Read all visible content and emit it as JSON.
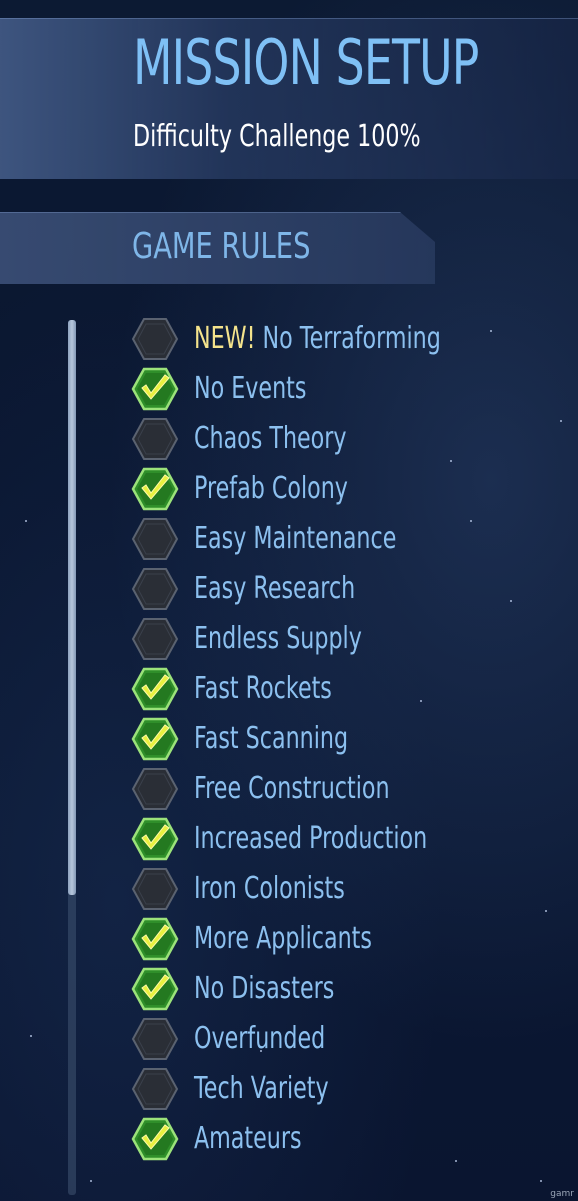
{
  "header": {
    "title": "MISSION SETUP",
    "subtitle": "Difficulty Challenge 100%"
  },
  "section": {
    "title": "GAME RULES"
  },
  "rules": [
    {
      "new_tag": "NEW!",
      "label": "No Terraforming",
      "checked": false
    },
    {
      "label": "No Events",
      "checked": true
    },
    {
      "label": "Chaos Theory",
      "checked": false
    },
    {
      "label": "Prefab Colony",
      "checked": true
    },
    {
      "label": "Easy Maintenance",
      "checked": false
    },
    {
      "label": "Easy Research",
      "checked": false
    },
    {
      "label": "Endless Supply",
      "checked": false
    },
    {
      "label": "Fast Rockets",
      "checked": true
    },
    {
      "label": "Fast Scanning",
      "checked": true
    },
    {
      "label": "Free Construction",
      "checked": false
    },
    {
      "label": "Increased Production",
      "checked": true
    },
    {
      "label": "Iron Colonists",
      "checked": false
    },
    {
      "label": "More Applicants",
      "checked": true
    },
    {
      "label": "No Disasters",
      "checked": true
    },
    {
      "label": "Overfunded",
      "checked": false
    },
    {
      "label": "Tech Variety",
      "checked": false
    },
    {
      "label": "Amateurs",
      "checked": true
    }
  ],
  "scrollbar": {
    "position": 0
  },
  "watermark": "gamr",
  "colors": {
    "title": "#7fc0f5",
    "rule_label": "#8cc0ef",
    "new_tag": "#f4e38c",
    "checked_fill": "#2f8f2a",
    "check_mark": "#e8f040",
    "unchecked_fill": "#2a2e36"
  }
}
